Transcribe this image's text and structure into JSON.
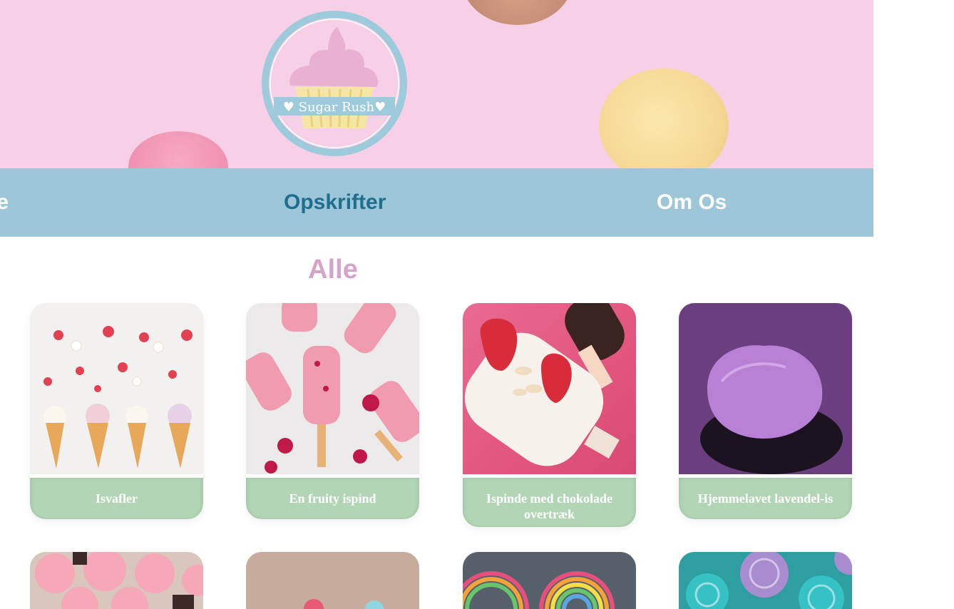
{
  "header": {
    "logo_text": "♥ Sugar Rush♥"
  },
  "nav": {
    "items": [
      {
        "label": "Alle"
      },
      {
        "label": "Opskrifter"
      },
      {
        "label": "Om Os"
      }
    ]
  },
  "main": {
    "heading": "Alle",
    "recipes": [
      {
        "title": "Isvafler"
      },
      {
        "title": "En fruity ispind"
      },
      {
        "title": "Ispinde med chokolade overtræk"
      },
      {
        "title": "Hjemmelavet lavendel-is"
      }
    ]
  },
  "colors": {
    "hero_bg": "#f7d0e8",
    "nav_bg": "#9dc6d9",
    "nav_active": "#1f6e8e",
    "heading": "#d7a3c6",
    "caption_bg": "#b2d6b5"
  }
}
